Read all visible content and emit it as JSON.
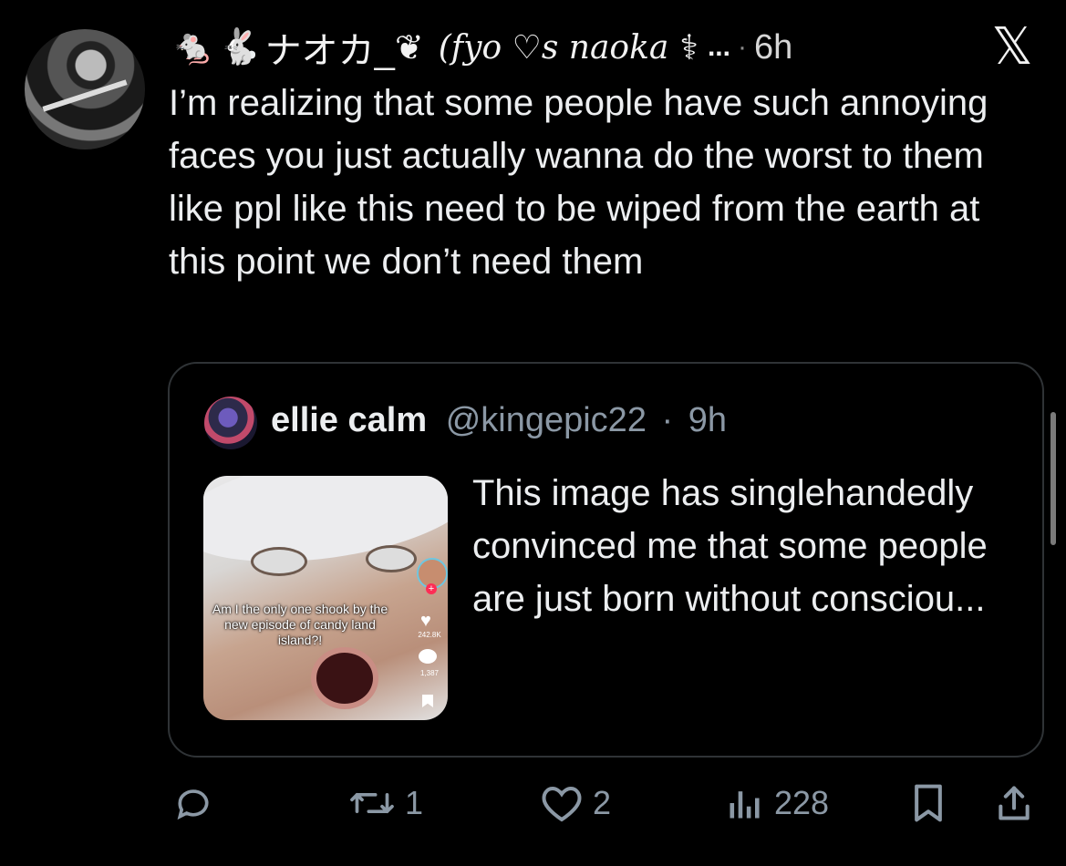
{
  "tweet": {
    "display_name": "ナオカ_",
    "display_name_script": "(fyo ♡s naoka",
    "truncation": "...",
    "separator": "·",
    "time": "6h",
    "text": "I’m realizing that some people have such annoying faces you just actually wanna do the worst to them like ppl like this need to be wiped from the earth at this point we don’t need them",
    "header_emojis": [
      "rat-emoji",
      "rabbit-emoji",
      "wing-emoji",
      "bone-emoji"
    ]
  },
  "quoted": {
    "name": "ellie calm",
    "handle": "@kingepic22",
    "separator": "·",
    "time": "9h",
    "text": "This image has singlehandedly convinced me that some people are just born without consciou...",
    "thumbnail": {
      "caption": "Am I the only one shook by the new episode of candy land island?!",
      "likes": "242.8K",
      "comments": "1,387"
    }
  },
  "actions": {
    "retweets": "1",
    "likes": "2",
    "views": "228"
  },
  "colors": {
    "background": "#000000",
    "text": "#e7e9ea",
    "muted": "#8b98a5",
    "border": "#2f3336"
  }
}
